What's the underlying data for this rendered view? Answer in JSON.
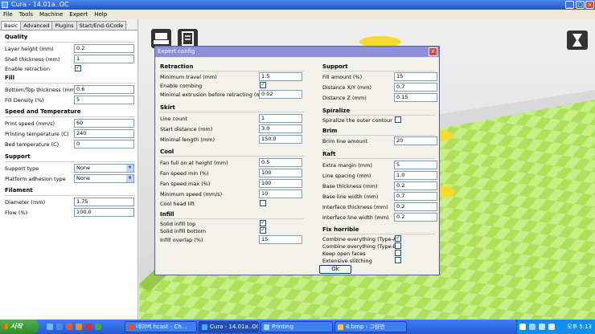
{
  "window": {
    "title": "Cura - 14.01a..OC",
    "menu": [
      "File",
      "Tools",
      "Machine",
      "Expert",
      "Help"
    ]
  },
  "left_panel": {
    "tabs": [
      "Basic",
      "Advanced",
      "Plugins",
      "Start/End-GCode"
    ],
    "sections": {
      "quality": {
        "title": "Quality",
        "layer_height": {
          "label": "Layer height (mm)",
          "value": "0.2"
        },
        "shell_thickness": {
          "label": "Shell thickness (mm)",
          "value": "1"
        },
        "enable_retraction": {
          "label": "Enable retraction",
          "checked": true
        }
      },
      "fill": {
        "title": "Fill",
        "bottom_top_thickness": {
          "label": "Bottom/Top thickness (mm)",
          "value": "0.6"
        },
        "fill_density": {
          "label": "Fill Density (%)",
          "value": "5"
        }
      },
      "speed": {
        "title": "Speed and Temperature",
        "print_speed": {
          "label": "Print speed (mm/s)",
          "value": "60"
        },
        "printing_temp": {
          "label": "Printing temperature (C)",
          "value": "240"
        },
        "bed_temp": {
          "label": "Bed temperature (C)",
          "value": "0"
        }
      },
      "support": {
        "title": "Support",
        "support_type": {
          "label": "Support type",
          "value": "None"
        },
        "platform_adhesion": {
          "label": "Platform adhesion type",
          "value": "None"
        }
      },
      "filament": {
        "title": "Filament",
        "diameter": {
          "label": "Diameter (mm)",
          "value": "1.75"
        },
        "flow": {
          "label": "Flow (%)",
          "value": "100.0"
        }
      }
    }
  },
  "dialog": {
    "title": "Expert config",
    "ok_label": "Ok",
    "retraction": {
      "title": "Retraction",
      "minimum_travel": {
        "label": "Minimum travel (mm)",
        "value": "1.5"
      },
      "enable_combing": {
        "label": "Enable combing",
        "checked": true
      },
      "minimal_extrusion": {
        "label": "Minimal extrusion before retracting (mm)",
        "value": "0.02"
      }
    },
    "skirt": {
      "title": "Skirt",
      "line_count": {
        "label": "Line count",
        "value": "1"
      },
      "start_distance": {
        "label": "Start distance (mm)",
        "value": "3.0"
      },
      "minimal_length": {
        "label": "Minimal length (mm)",
        "value": "150.0"
      }
    },
    "cool": {
      "title": "Cool",
      "fan_full_on": {
        "label": "Fan full on at height (mm)",
        "value": "0.5"
      },
      "fan_speed_min": {
        "label": "Fan speed min (%)",
        "value": "100"
      },
      "fan_speed_max": {
        "label": "Fan speed max (%)",
        "value": "100"
      },
      "minimum_speed": {
        "label": "Minimum speed (mm/s)",
        "value": "10"
      },
      "cool_head_lift": {
        "label": "Cool head lift",
        "checked": false
      }
    },
    "infill": {
      "title": "Infill",
      "solid_infill_top": {
        "label": "Solid infill top",
        "checked": true
      },
      "solid_infill_bottom": {
        "label": "Solid infill bottom",
        "checked": true
      },
      "infill_overlap": {
        "label": "Infill overlap (%)",
        "value": "15"
      }
    },
    "support": {
      "title": "Support",
      "fill_amount": {
        "label": "Fill amount (%)",
        "value": "15"
      },
      "distance_xy": {
        "label": "Distance X/Y (mm)",
        "value": "0.7"
      },
      "distance_z": {
        "label": "Distance Z (mm)",
        "value": "0.15"
      }
    },
    "spiralize": {
      "title": "Spiralize",
      "spiralize_outer": {
        "label": "Spiralize the outer contour",
        "checked": false
      }
    },
    "brim": {
      "title": "Brim",
      "brim_line_amount": {
        "label": "Brim line amount",
        "value": "20"
      }
    },
    "raft": {
      "title": "Raft",
      "extra_margin": {
        "label": "Extra margin (mm)",
        "value": "5"
      },
      "line_spacing": {
        "label": "Line spacing (mm)",
        "value": "1.0"
      },
      "base_thickness": {
        "label": "Base thickness (mm)",
        "value": "0.2"
      },
      "base_line_width": {
        "label": "Base line width (mm)",
        "value": "0.7"
      },
      "interface_thickness": {
        "label": "Interface thickness (mm)",
        "value": "0.2"
      },
      "interface_line_width": {
        "label": "Interface line width (mm)",
        "value": "0.2"
      }
    },
    "fix_horrible": {
      "title": "Fix horrible",
      "combine_a": {
        "label": "Combine everything (Type-A)",
        "checked": true
      },
      "combine_b": {
        "label": "Combine everything (Type-B)",
        "checked": false
      },
      "keep_open_faces": {
        "label": "Keep open faces",
        "checked": false
      },
      "extensive_stitching": {
        "label": "Extensive stitching",
        "checked": false
      }
    }
  },
  "taskbar": {
    "start_label": "시작",
    "items": [
      {
        "label": "네이버 hcast - Ch...",
        "icon_color": "#e84a2e"
      },
      {
        "label": "Cura - 14.01a..OC",
        "icon_color": "#4aa6ff"
      },
      {
        "label": "Printing",
        "icon_color": "#9fd0ff"
      },
      {
        "label": "4.bmp - 그림판",
        "icon_color": "#f3c645"
      }
    ],
    "clock": "오후 5:13"
  },
  "colors": {
    "accent": "#1f55c5",
    "dialog_title": "#8d8fd8",
    "plate_green": "#aee05a",
    "object_yellow": "#f5dc2c",
    "check_green": "#21a121"
  }
}
